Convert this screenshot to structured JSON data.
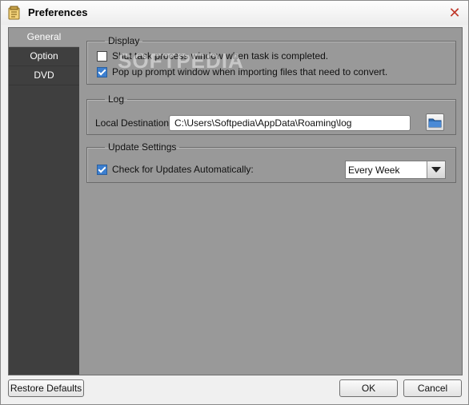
{
  "window": {
    "title": "Preferences"
  },
  "sidebar": {
    "items": [
      {
        "label": "General",
        "active": true
      },
      {
        "label": "Option",
        "active": false
      },
      {
        "label": "DVD",
        "active": false
      }
    ]
  },
  "display": {
    "legend": "Display",
    "options": [
      {
        "label": "Shut task process window when task is completed.",
        "checked": false
      },
      {
        "label": "Pop up prompt window when importing files that need to convert.",
        "checked": true
      }
    ]
  },
  "log": {
    "legend": "Log",
    "destination_label": "Local Destination:",
    "destination_value": "C:\\Users\\Softpedia\\AppData\\Roaming\\log"
  },
  "update": {
    "legend": "Update Settings",
    "check_label": "Check for Updates Automatically:",
    "checked": true,
    "frequency": "Every Week"
  },
  "watermark": "SOFTPEDIA",
  "buttons": {
    "restore": "Restore Defaults",
    "ok": "OK",
    "cancel": "Cancel"
  },
  "colors": {
    "sidebar": "#3f3f3f",
    "panel": "#999999",
    "accent": "#3c7fd0",
    "close": "#c0392b"
  }
}
